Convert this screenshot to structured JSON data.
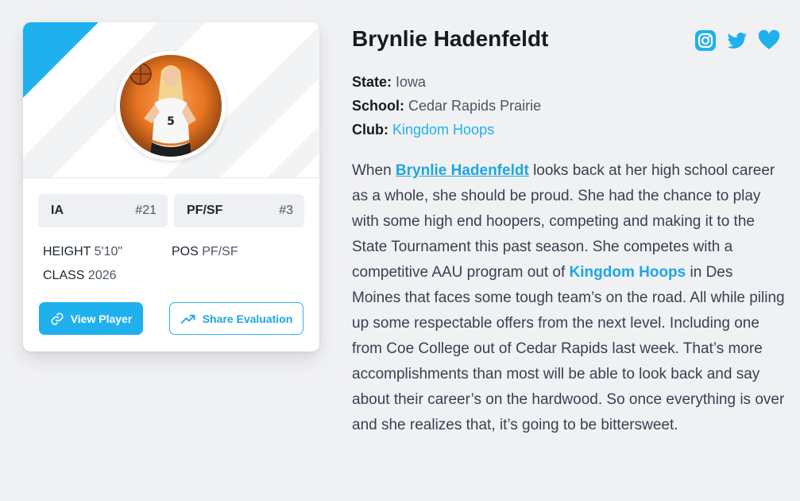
{
  "card": {
    "state_chip": {
      "label": "IA",
      "value": "#21"
    },
    "position_chip": {
      "label": "PF/SF",
      "value": "#3"
    },
    "height_label": "HEIGHT",
    "height_value": "5'10\"",
    "pos_label": "POS",
    "pos_value": "PF/SF",
    "class_label": "CLASS",
    "class_value": "2026",
    "view_button": "View Player",
    "share_button": "Share Evaluation"
  },
  "player": {
    "name": "Brynlie Hadenfeldt",
    "state_label": "State:",
    "state_value": "Iowa",
    "school_label": "School:",
    "school_value": "Cedar Rapids Prairie",
    "club_label": "Club:",
    "club_value": "Kingdom Hoops"
  },
  "bio": {
    "p1": "When ",
    "link1": "Brynlie Hadenfeldt",
    "p2": " looks back at her high school career as a whole, she should be proud. She had the chance to play with some high end hoopers, competing and making it to the State Tournament this past season. She competes with a competitive AAU program out of ",
    "link2": "Kingdom Hoops",
    "p3": " in Des Moines that faces some tough team’s on the road. All while piling up some respectable offers from the next level. Including one from Coe College out of Cedar Rapids last week. That’s more accomplishments than most will be able to look back and say about their career’s on the hardwood. So once everything is over and she realizes that, it’s going to be bittersweet."
  },
  "socials": [
    "instagram-icon",
    "twitter-icon",
    "heart-icon"
  ],
  "colors": {
    "accent": "#1fb0ee",
    "background": "#f0f1f3",
    "card": "#ffffff"
  }
}
